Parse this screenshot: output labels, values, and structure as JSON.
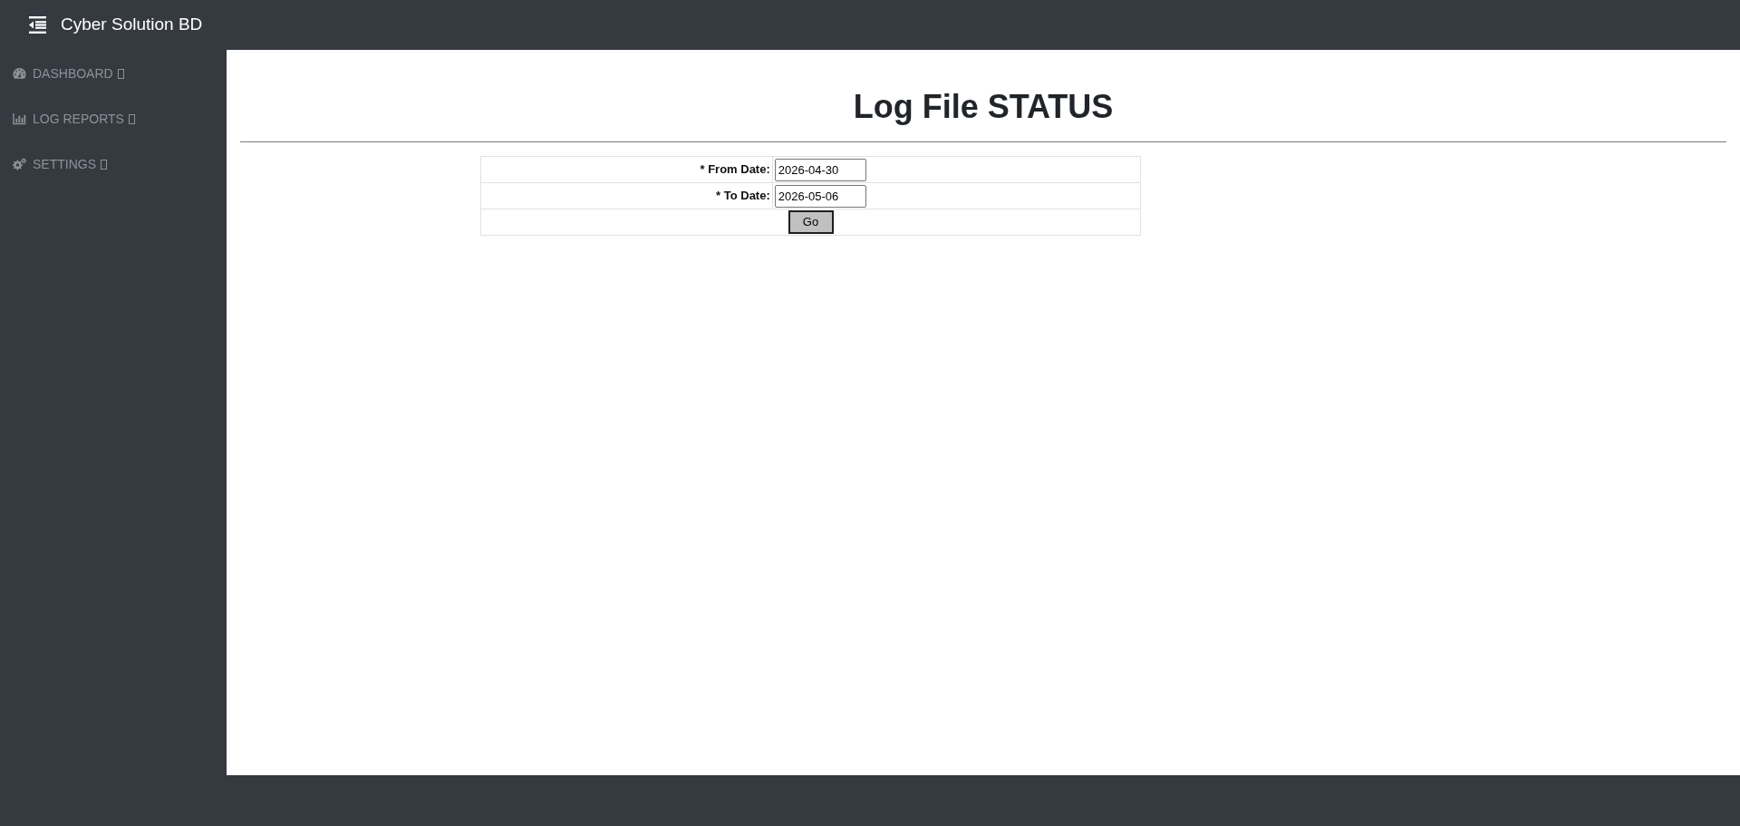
{
  "header": {
    "brand": "Cyber Solution BD"
  },
  "sidebar": {
    "items": [
      {
        "kind": "dashboard",
        "label": "DASHBOARD"
      },
      {
        "kind": "reports",
        "label": "LOG REPORTS"
      },
      {
        "kind": "settings",
        "label": "SETTINGS"
      }
    ]
  },
  "page": {
    "title": "Log File STATUS"
  },
  "form": {
    "fields": [
      {
        "label": "* From Date:",
        "value": "2026-04-30"
      },
      {
        "label": "* To Date:",
        "value": "2026-05-06"
      }
    ],
    "submit": {
      "label": "Go"
    }
  }
}
